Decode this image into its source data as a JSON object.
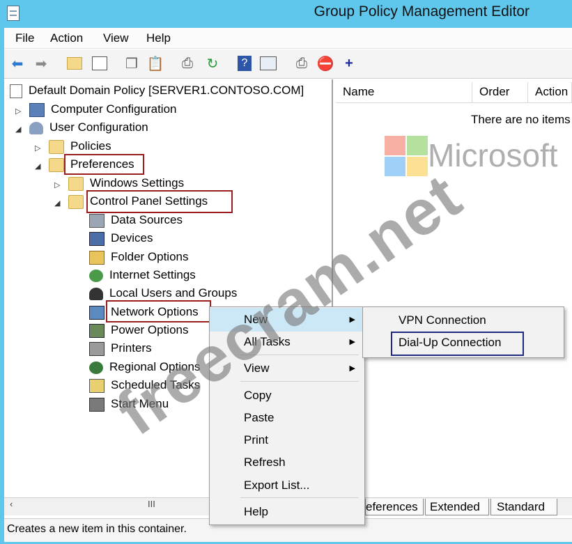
{
  "window": {
    "title": "Group Policy Management Editor"
  },
  "menu": [
    "File",
    "Action",
    "View",
    "Help"
  ],
  "toolbar_icons": [
    "back-arrow-icon",
    "forward-arrow-icon",
    "up-folder-icon",
    "show-hide-tree-icon",
    "copy-icon",
    "paste-icon",
    "print-icon",
    "refresh-icon",
    "help-icon",
    "properties-icon",
    "filter-icon",
    "stop-icon",
    "add-icon"
  ],
  "tree": {
    "root": "Default Domain Policy [SERVER1.CONTOSO.COM]",
    "computer_config": "Computer Configuration",
    "user_config": "User Configuration",
    "policies": "Policies",
    "preferences": "Preferences",
    "windows_settings": "Windows Settings",
    "control_panel_settings": "Control Panel Settings",
    "items": [
      "Data Sources",
      "Devices",
      "Folder Options",
      "Internet Settings",
      "Local Users and Groups",
      "Network Options",
      "Power Options",
      "Printers",
      "Regional Options",
      "Scheduled Tasks",
      "Start Menu"
    ]
  },
  "right_pane": {
    "columns": [
      "Name",
      "Order",
      "Action"
    ],
    "empty_text": "There are no items"
  },
  "context_menu": {
    "new": "New",
    "all_tasks": "All Tasks",
    "view": "View",
    "copy": "Copy",
    "paste": "Paste",
    "print": "Print",
    "refresh": "Refresh",
    "export_list": "Export List...",
    "help": "Help"
  },
  "submenu": {
    "vpn": "VPN Connection",
    "dialup": "Dial-Up Connection"
  },
  "tabs": [
    "eferences",
    "Extended",
    "Standard"
  ],
  "scroll_thumb_text": "III",
  "status": "Creates a new item in this container.",
  "watermark": {
    "site": "freecram.net",
    "brand": "Microsoft"
  },
  "colors": {
    "titlebar": "#5fc6ec",
    "highlight_red": "#9a1c1c",
    "highlight_blue": "#1d2a80",
    "menu_hover": "#cce8f6"
  }
}
